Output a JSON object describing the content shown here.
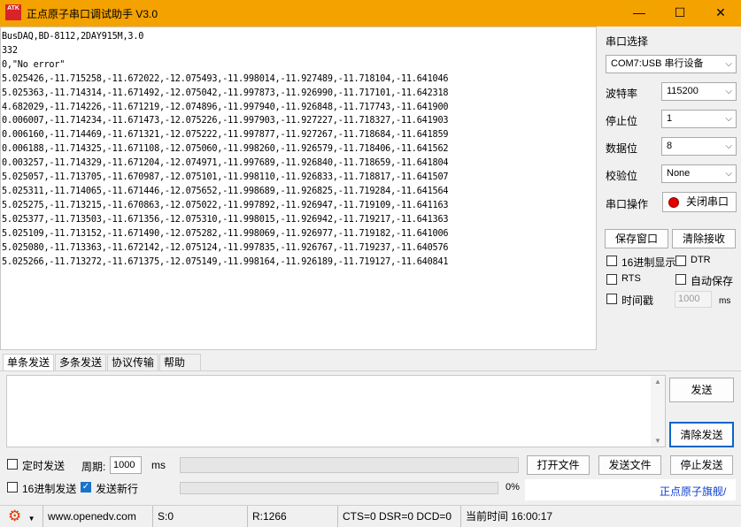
{
  "window": {
    "logo": "ATK",
    "title": "正点原子串口调试助手 V3.0",
    "min_icon": "minimize-icon",
    "max_icon": "maximize-icon",
    "close_icon": "close-icon"
  },
  "receive": {
    "text": "BusDAQ,BD-8112,2DAY915M,3.0\n332\n0,\"No error\"\n5.025426,-11.715258,-11.672022,-12.075493,-11.998014,-11.927489,-11.718104,-11.641046\n5.025363,-11.714314,-11.671492,-12.075042,-11.997873,-11.926990,-11.717101,-11.642318\n4.682029,-11.714226,-11.671219,-12.074896,-11.997940,-11.926848,-11.717743,-11.641900\n0.006007,-11.714234,-11.671473,-12.075226,-11.997903,-11.927227,-11.718327,-11.641903\n0.006160,-11.714469,-11.671321,-12.075222,-11.997877,-11.927267,-11.718684,-11.641859\n0.006188,-11.714325,-11.671108,-12.075060,-11.998260,-11.926579,-11.718406,-11.641562\n0.003257,-11.714329,-11.671204,-12.074971,-11.997689,-11.926840,-11.718659,-11.641804\n5.025057,-11.713705,-11.670987,-12.075101,-11.998110,-11.926833,-11.718817,-11.641507\n5.025311,-11.714065,-11.671446,-12.075652,-11.998689,-11.926825,-11.719284,-11.641564\n5.025275,-11.713215,-11.670863,-12.075022,-11.997892,-11.926947,-11.719109,-11.641163\n5.025377,-11.713503,-11.671356,-12.075310,-11.998015,-11.926942,-11.719217,-11.641363\n5.025109,-11.713152,-11.671490,-12.075282,-11.998069,-11.926977,-11.719182,-11.641006\n5.025080,-11.713363,-11.672142,-12.075124,-11.997835,-11.926767,-11.719237,-11.640576\n5.025266,-11.713272,-11.671375,-12.075149,-11.998164,-11.926189,-11.719127,-11.640841"
  },
  "settings": {
    "port_label": "串口选择",
    "port_value": "COM7:USB 串行设备",
    "baud_label": "波特率",
    "baud_value": "115200",
    "stop_label": "停止位",
    "stop_value": "1",
    "data_label": "数据位",
    "data_value": "8",
    "parity_label": "校验位",
    "parity_value": "None",
    "op_label": "串口操作",
    "close_port_button": "关闭串口",
    "save_window_button": "保存窗口",
    "clear_receive_button": "清除接收",
    "hex_display": "16进制显示",
    "dtr": "DTR",
    "rts": "RTS",
    "auto_save": "自动保存",
    "timestamp": "时间戳",
    "timestamp_value": "1000",
    "timestamp_unit": "ms"
  },
  "tabs": [
    "单条发送",
    "多条发送",
    "协议传输",
    "帮助"
  ],
  "send": {
    "send_button": "发送",
    "clear_send_button": "清除发送",
    "timed_send": "定时发送",
    "period_label": "周期:",
    "period_value": "1000",
    "period_unit": "ms",
    "open_file_button": "打开文件",
    "send_file_button": "发送文件",
    "stop_send_button": "停止发送",
    "hex_send": "16进制发送",
    "send_newline": "发送新行",
    "progress_text": "0%",
    "progress": 0,
    "ad_text": "正点原子旗舰/"
  },
  "status": {
    "url": "www.openedv.com",
    "sent": "S:0",
    "received": "R:1266",
    "signals": "CTS=0 DSR=0 DCD=0",
    "time": "当前时间 16:00:17"
  }
}
